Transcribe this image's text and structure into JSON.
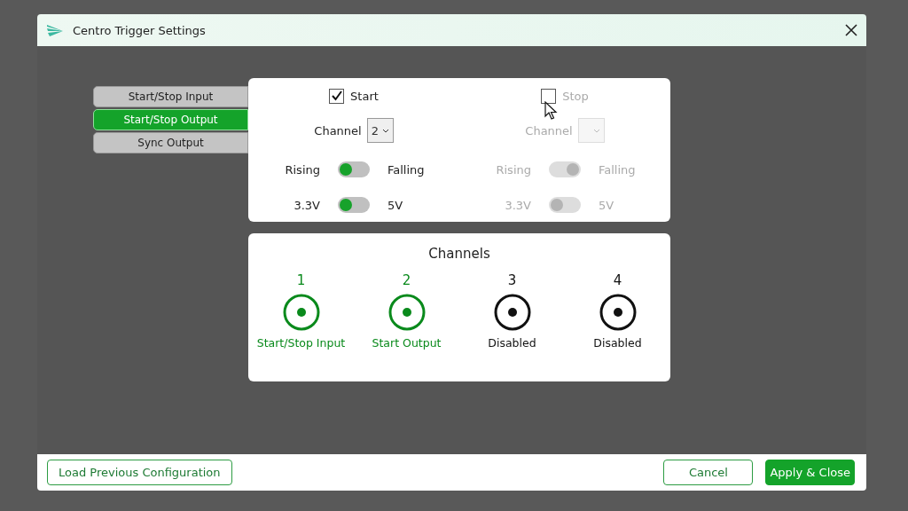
{
  "window": {
    "title": "Centro Trigger Settings"
  },
  "tabs": [
    {
      "label": "Start/Stop Input",
      "selected": false
    },
    {
      "label": "Start/Stop Output",
      "selected": true
    },
    {
      "label": "Sync Output",
      "selected": false
    }
  ],
  "triggers": [
    {
      "label": "Start",
      "checked": true,
      "disabled": false,
      "channel_label": "Channel",
      "channel_value": "2",
      "toggles": [
        {
          "off_label": "Rising",
          "on_label": "Falling",
          "on": false
        },
        {
          "off_label": "3.3V",
          "on_label": "5V",
          "on": false
        }
      ]
    },
    {
      "label": "Stop",
      "checked": false,
      "disabled": true,
      "channel_label": "Channel",
      "toggles": [
        {
          "off_label": "Rising",
          "on_label": "Falling",
          "on": true
        },
        {
          "off_label": "3.3V",
          "on_label": "5V",
          "on": false
        }
      ]
    }
  ],
  "channels": {
    "title": "Channels",
    "items": [
      {
        "number": "1",
        "label": "Start/Stop Input",
        "active": true
      },
      {
        "number": "2",
        "label": "Start Output",
        "active": true
      },
      {
        "number": "3",
        "label": "Disabled",
        "active": false
      },
      {
        "number": "4",
        "label": "Disabled",
        "active": false
      }
    ]
  },
  "footer": {
    "load_button": "Load Previous Configuration",
    "cancel_button": "Cancel",
    "apply_button": "Apply & Close"
  }
}
